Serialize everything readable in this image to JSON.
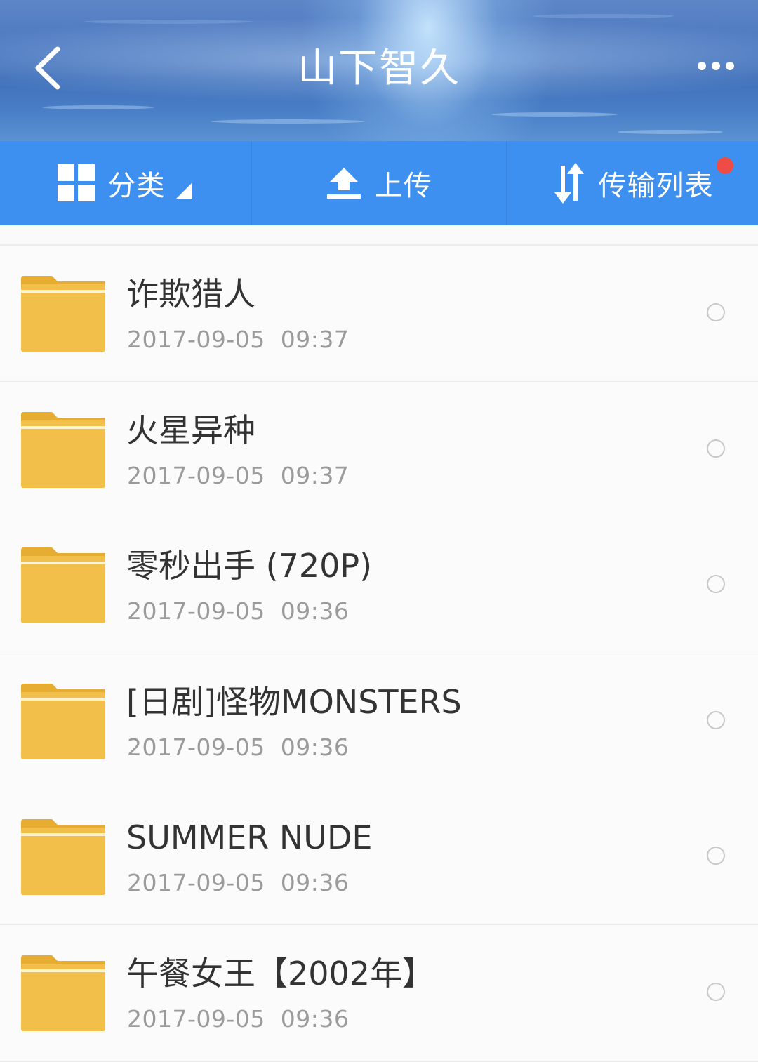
{
  "header": {
    "title": "山下智久",
    "back_icon": "chevron-left-icon",
    "more_icon": "more-horizontal-icon"
  },
  "toolbar": {
    "category": {
      "label": "分类",
      "icon": "grid-icon"
    },
    "upload": {
      "label": "上传",
      "icon": "upload-icon"
    },
    "transfer": {
      "label": "传输列表",
      "icon": "transfer-arrows-icon",
      "has_notification": true
    }
  },
  "colors": {
    "toolbar_blue": "#3d8ff0",
    "folder_yellow": "#f2c04a",
    "notification_red": "#f04c46"
  },
  "files": [
    {
      "name": "诈欺猎人",
      "date": "2017-09-05  09:37",
      "type": "folder",
      "selected": false
    },
    {
      "name": "火星异种",
      "date": "2017-09-05  09:37",
      "type": "folder",
      "selected": false
    },
    {
      "name": "零秒出手 (720P)",
      "date": "2017-09-05  09:36",
      "type": "folder",
      "selected": false
    },
    {
      "name": "[日剧]怪物MONSTERS",
      "date": "2017-09-05  09:36",
      "type": "folder",
      "selected": false
    },
    {
      "name": "SUMMER NUDE",
      "date": "2017-09-05  09:36",
      "type": "folder",
      "selected": false
    },
    {
      "name": "午餐女王【2002年】",
      "date": "2017-09-05  09:36",
      "type": "folder",
      "selected": false
    }
  ]
}
